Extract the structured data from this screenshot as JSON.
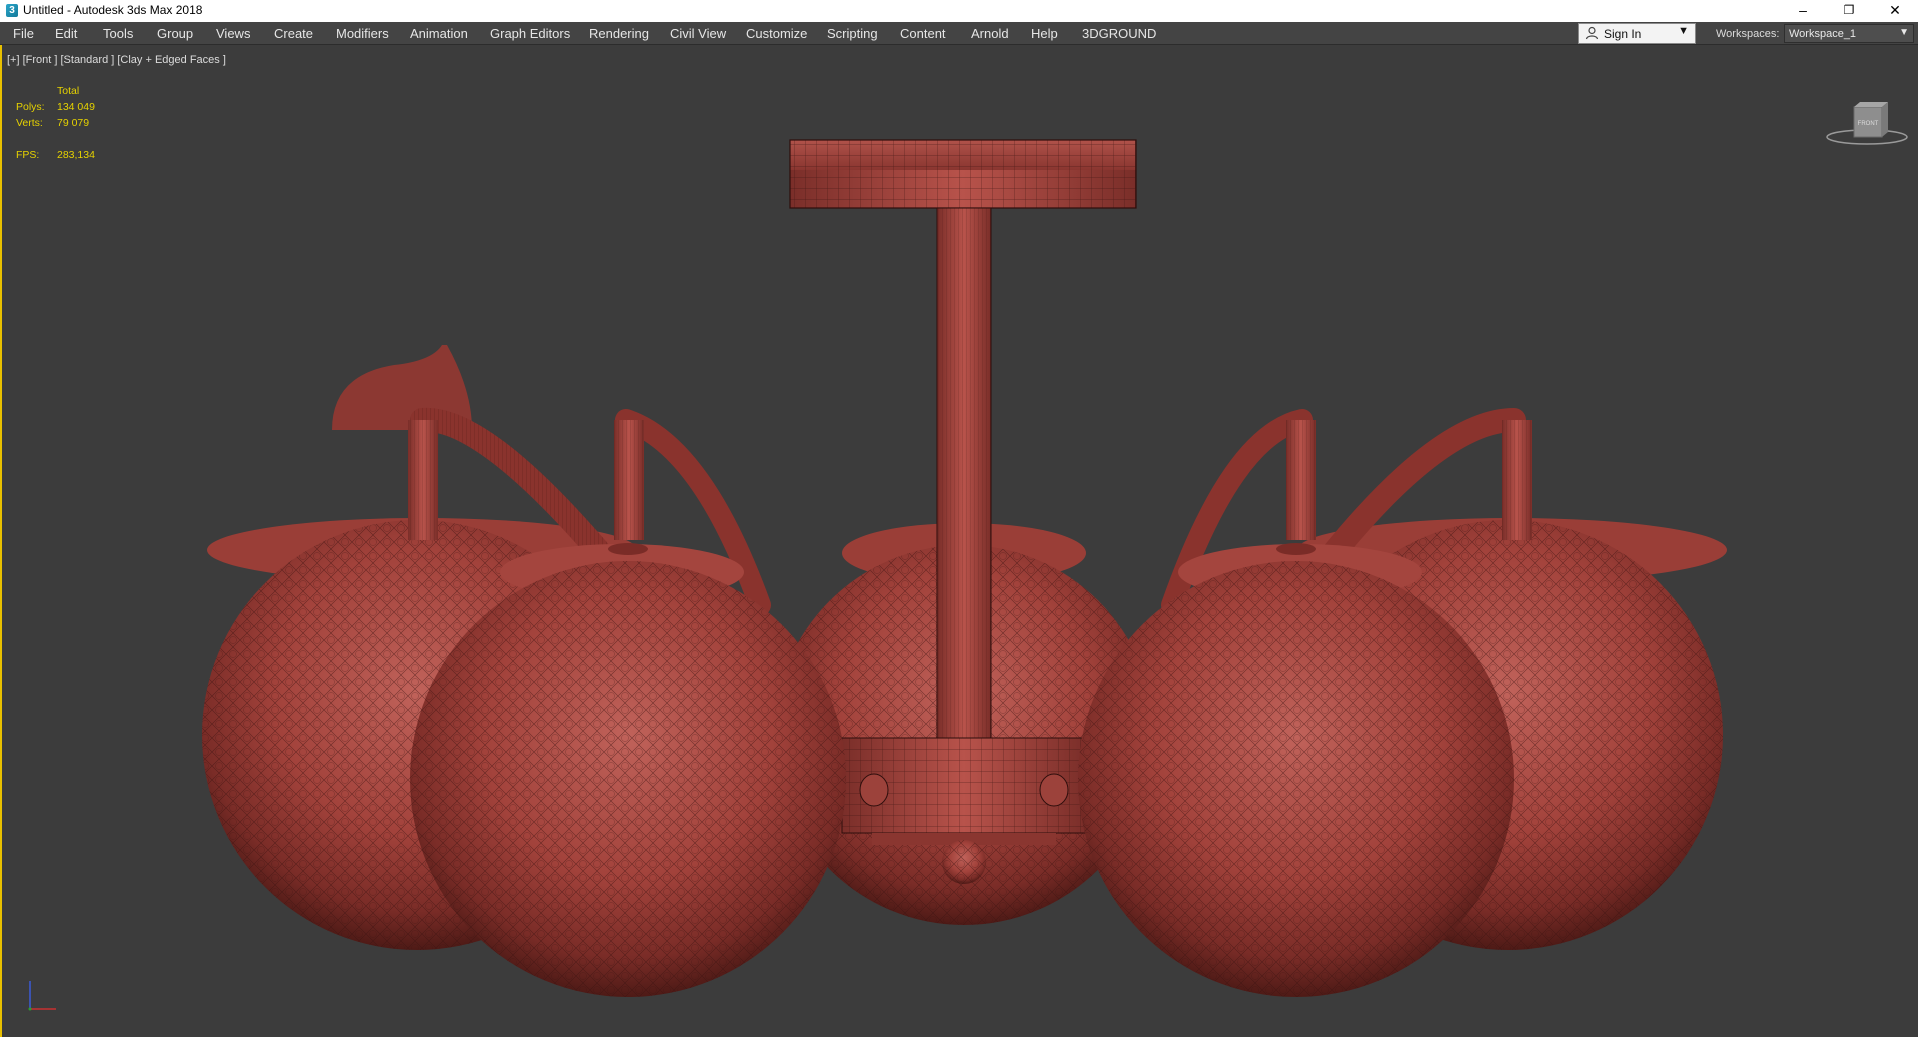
{
  "titlebar": {
    "title": "Untitled - Autodesk 3ds Max 2018",
    "icon": "3ds-max-app-icon",
    "minimize_icon": "–",
    "restore_icon": "❐",
    "close_icon": "✕"
  },
  "menu": {
    "items": [
      "File",
      "Edit",
      "Tools",
      "Group",
      "Views",
      "Create",
      "Modifiers",
      "Animation",
      "Graph Editors",
      "Rendering",
      "Civil View",
      "Customize",
      "Scripting",
      "Content",
      "Arnold",
      "Help",
      "3DGROUND"
    ]
  },
  "account": {
    "sign_in_label": "Sign In",
    "workspaces_label": "Workspaces:",
    "workspace_value": "Workspace_1"
  },
  "viewport": {
    "label": "[+] [Front ] [Standard ] [Clay + Edged Faces ]",
    "stats": {
      "header": "Total",
      "polys_label": "Polys:",
      "polys_value": "134 049",
      "verts_label": "Verts:",
      "verts_value": "79 079",
      "fps_label": "FPS:",
      "fps_value": "283,134"
    },
    "viewcube_label": "FRONT"
  },
  "colors": {
    "accent_border": "#e8c000",
    "stats_text": "#e6d200",
    "model_red": "#a8403a"
  }
}
